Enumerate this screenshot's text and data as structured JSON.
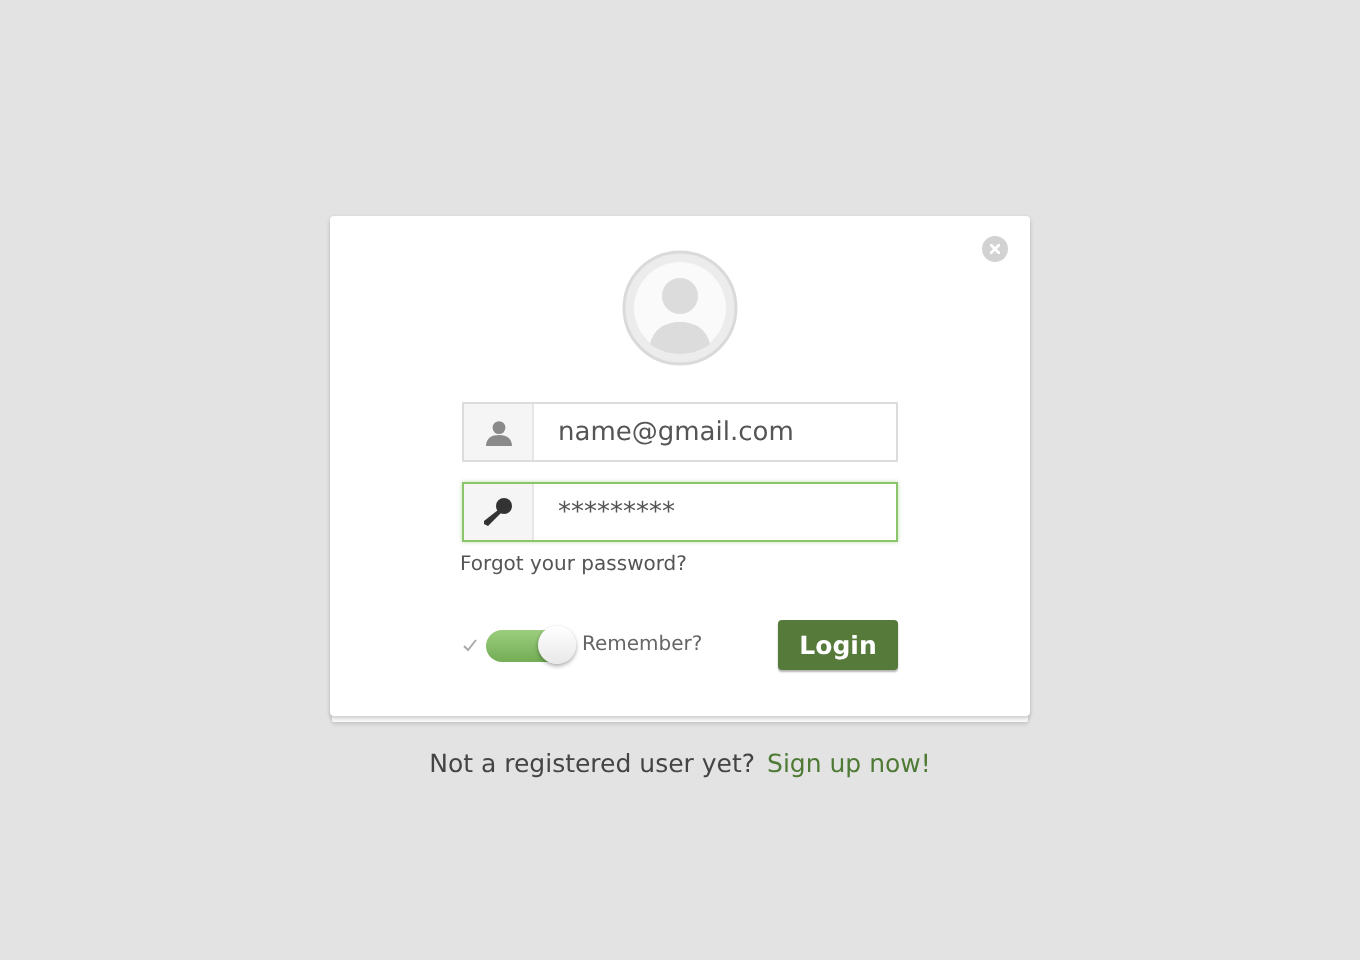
{
  "login_card": {
    "fields": [
      {
        "kind": "user",
        "value": "name@gmail.com",
        "focused": false
      },
      {
        "kind": "password",
        "value": "*********",
        "focused": true
      }
    ],
    "forgot_link": "Forgot your password?",
    "remember": {
      "label": "Remember?",
      "on": true
    },
    "login_button": "Login"
  },
  "signup": {
    "text": "Not a registered user yet?",
    "link": "Sign up now!"
  }
}
